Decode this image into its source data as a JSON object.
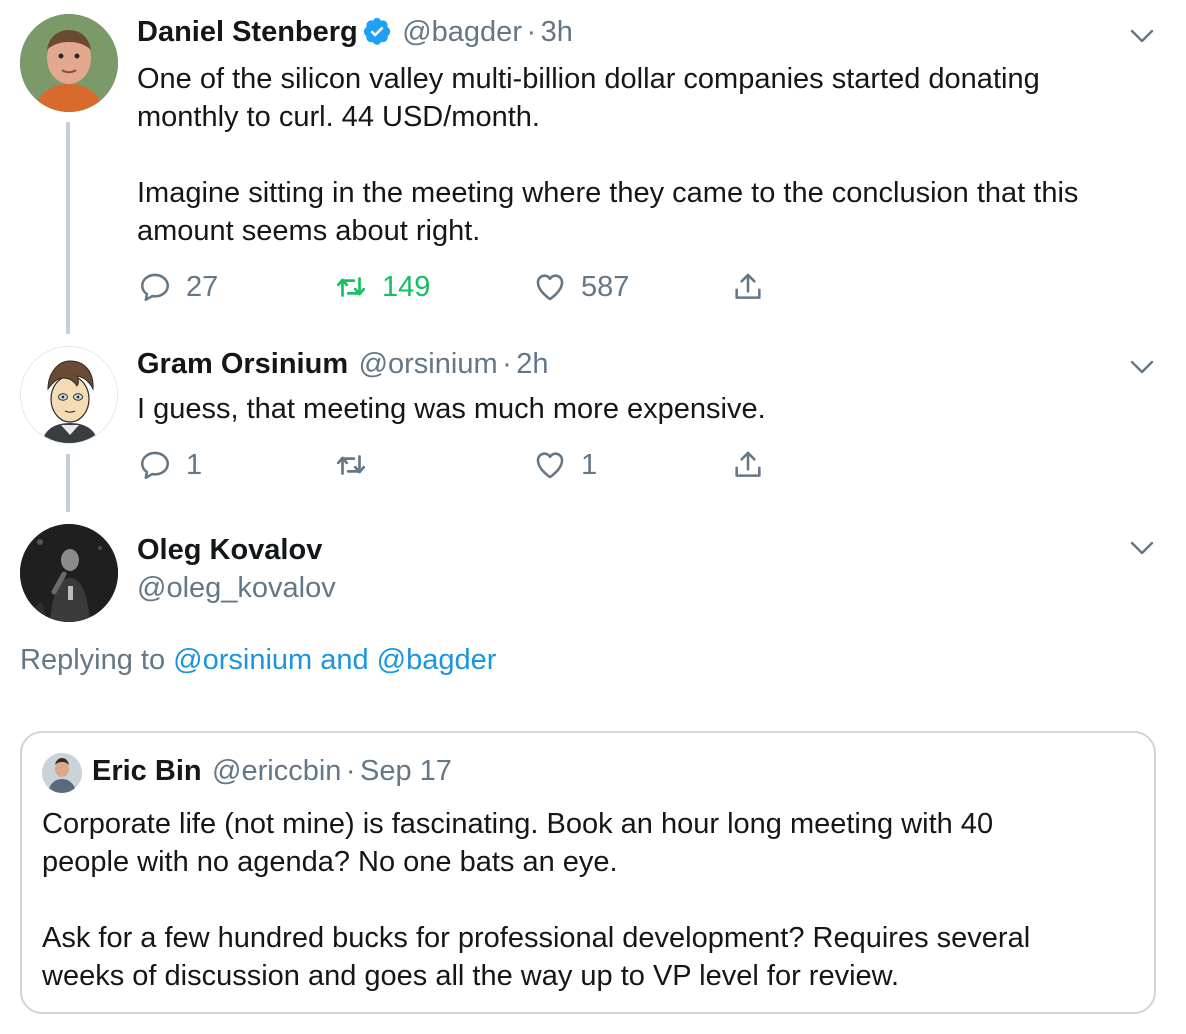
{
  "tweets": [
    {
      "name": "Daniel Stenberg",
      "handle": "@bagder",
      "sep": "·",
      "time": "3h",
      "verified": true,
      "text_lines": [
        "One of the silicon valley multi-billion dollar companies started donating",
        "monthly to curl. 44 USD/month.",
        "",
        "Imagine sitting in the meeting where they came to the conclusion that this",
        "amount seems about right."
      ],
      "replies": "27",
      "retweets": "149",
      "likes": "587"
    },
    {
      "name": "Gram Orsinium",
      "handle": "@orsinium",
      "sep": "·",
      "time": "2h",
      "text_lines": [
        "I guess, that meeting was much more expensive."
      ],
      "replies": "1",
      "retweets": "",
      "likes": "1"
    }
  ],
  "focused": {
    "name": "Oleg Kovalov",
    "handle": "@oleg_kovalov",
    "replying_prefix": "Replying to",
    "replying_targets": "@orsinium and @bagder"
  },
  "quote": {
    "name": "Eric Bin",
    "handle": "@ericcbin",
    "sep": "·",
    "time": "Sep 17",
    "text_lines": [
      "Corporate life (not mine) is fascinating. Book an hour long meeting with 40",
      "people with no agenda? No one bats an eye.",
      "",
      "Ask for a few hundred bucks for professional development? Requires several",
      "weeks of discussion and goes all the way up to VP level for review."
    ]
  },
  "colors": {
    "text": "#14171a",
    "secondary": "#657786",
    "link": "#1b95e0",
    "retweet_active": "#17bf63",
    "thread_line": "#c4cfd6",
    "border": "#ccd6dd"
  },
  "icons": {
    "reply": "reply-icon",
    "retweet": "retweet-icon",
    "like": "heart-icon",
    "share": "share-icon",
    "more": "chevron-down-icon",
    "verified": "verified-badge-icon"
  }
}
